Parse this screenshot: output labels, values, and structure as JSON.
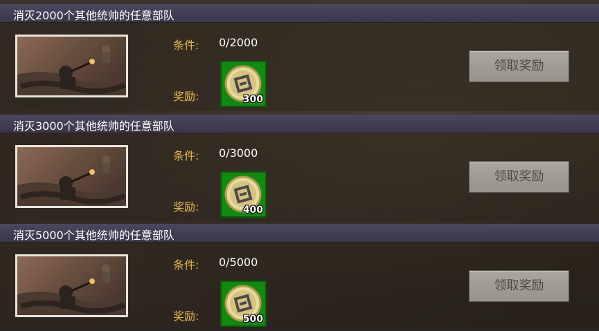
{
  "tasks": [
    {
      "title": "消灭2000个其他统帅的任意部队",
      "condition_label": "条件:",
      "condition_value": "0/2000",
      "reward_label": "奖励:",
      "reward_icon": "coin-icon",
      "reward_count": "300",
      "claim_label": "领取奖励"
    },
    {
      "title": "消灭3000个其他统帅的任意部队",
      "condition_label": "条件:",
      "condition_value": "0/3000",
      "reward_label": "奖励:",
      "reward_icon": "coin-icon",
      "reward_count": "400",
      "claim_label": "领取奖励"
    },
    {
      "title": "消灭5000个其他统帅的任意部队",
      "condition_label": "条件:",
      "condition_value": "0/5000",
      "reward_label": "奖励:",
      "reward_icon": "coin-icon",
      "reward_count": "500",
      "claim_label": "领取奖励"
    }
  ],
  "colors": {
    "label_gold": "#e8b84a",
    "header_purple": "#4c475e",
    "reward_green": "#118a12",
    "button_gray": "#a3a098"
  }
}
